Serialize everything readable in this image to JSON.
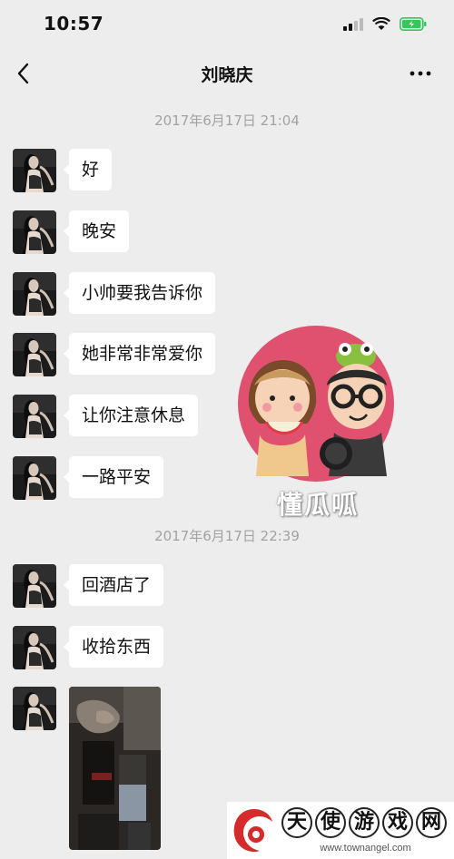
{
  "status_bar": {
    "time": "10:57"
  },
  "header": {
    "title": "刘晓庆"
  },
  "timestamps": [
    "2017年6月17日 21:04",
    "2017年6月17日 22:39"
  ],
  "messages_group1": [
    "好",
    "晚安",
    "小帅要我告诉你",
    "她非常非常爱你",
    "让你注意休息",
    "一路平安"
  ],
  "messages_group2": [
    "回酒店了",
    "收拾东西"
  ],
  "watermark": {
    "text": "懂瓜呱"
  },
  "site": {
    "chars": [
      "天",
      "使",
      "游",
      "戏",
      "网"
    ],
    "url": "www.townangel.com"
  },
  "colors": {
    "background": "#ededed",
    "bubble": "#ffffff",
    "timestamp": "#a2a2a2",
    "battery": "#34c759"
  }
}
